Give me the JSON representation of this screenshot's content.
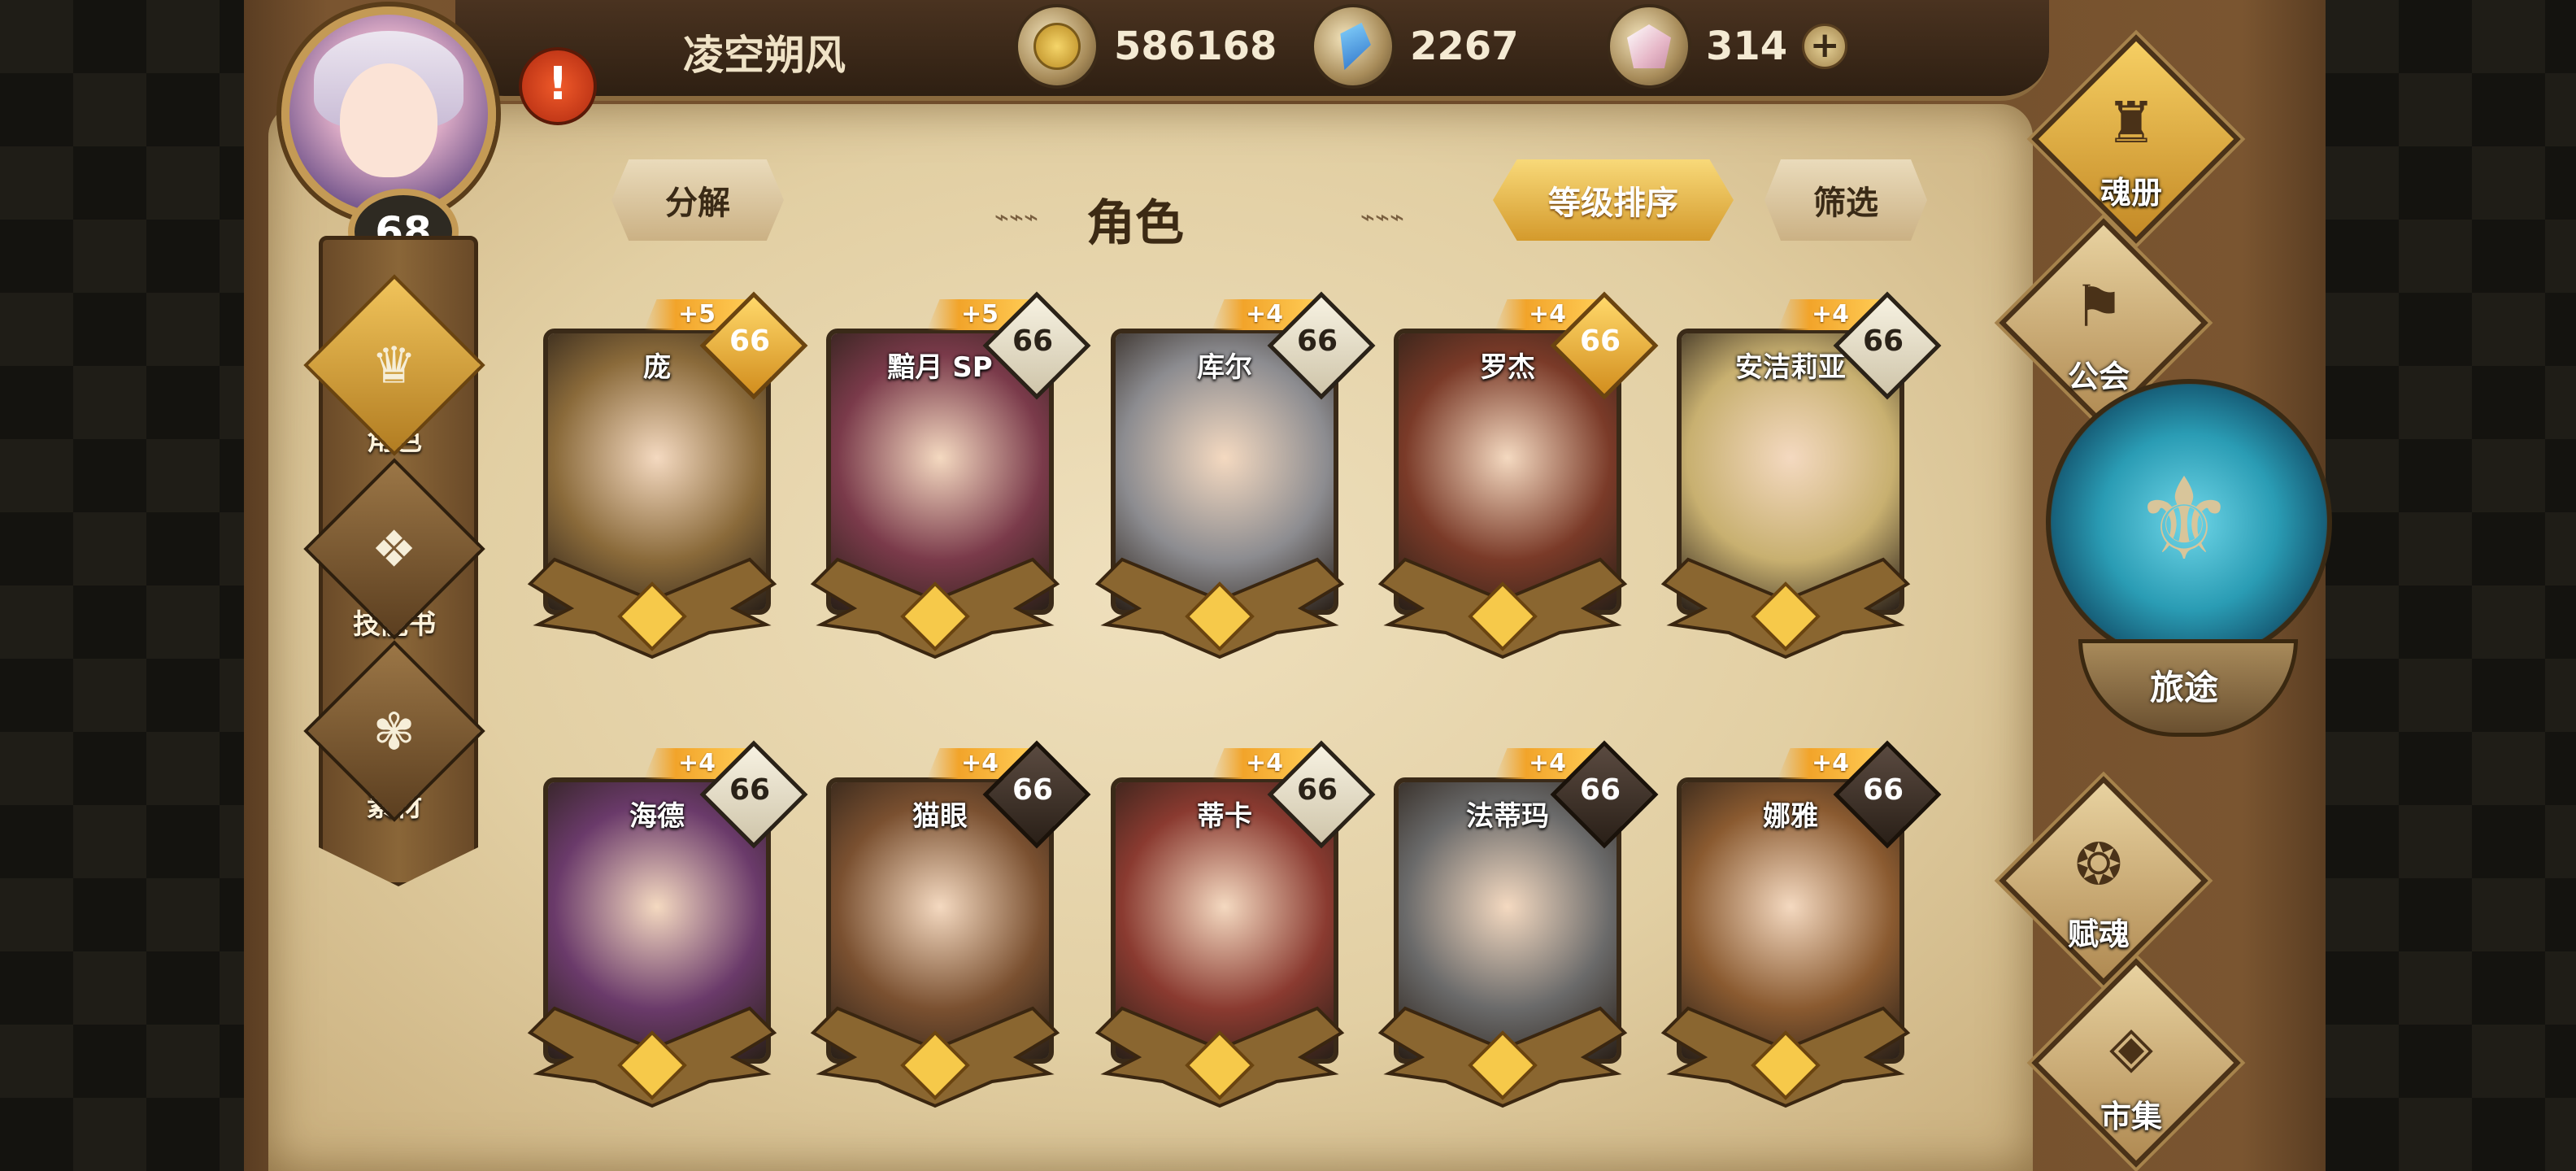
{
  "player": {
    "name": "凌空朔风",
    "level": "68",
    "alert": "!"
  },
  "resources": [
    {
      "icon": "gold-coin-icon",
      "value": "586168"
    },
    {
      "icon": "blue-gem-icon",
      "value": "2267"
    },
    {
      "icon": "pink-crystal-icon",
      "value": "314"
    }
  ],
  "add_label": "+",
  "header": {
    "title": "角色",
    "decompose": "分解",
    "sort": "等级排序",
    "filter": "筛选"
  },
  "left_menu": [
    {
      "label": "角色",
      "icon": "character-icon",
      "active": true
    },
    {
      "label": "技能书",
      "icon": "skill-book-icon",
      "active": false
    },
    {
      "label": "素材",
      "icon": "material-icon",
      "active": false
    }
  ],
  "cards": [
    {
      "name": "庞",
      "plus": "+5",
      "level": "66",
      "badge": "gold",
      "tint": "#8a6a3a"
    },
    {
      "name": "黯月 SP",
      "plus": "+5",
      "level": "66",
      "badge": "light",
      "tint": "#7a3a4a"
    },
    {
      "name": "库尔",
      "plus": "+4",
      "level": "66",
      "badge": "light",
      "tint": "#8c8c90"
    },
    {
      "name": "罗杰",
      "plus": "+4",
      "level": "66",
      "badge": "gold",
      "tint": "#7a3a28"
    },
    {
      "name": "安洁莉亚",
      "plus": "+4",
      "level": "66",
      "badge": "light",
      "tint": "#c8b070"
    },
    {
      "name": "海德",
      "plus": "+4",
      "level": "66",
      "badge": "light",
      "tint": "#6a3a6a"
    },
    {
      "name": "猫眼",
      "plus": "+4",
      "level": "66",
      "badge": "dark",
      "tint": "#7a5030"
    },
    {
      "name": "蒂卡",
      "plus": "+4",
      "level": "66",
      "badge": "light",
      "tint": "#8a3a30"
    },
    {
      "name": "法蒂玛",
      "plus": "+4",
      "level": "66",
      "badge": "dark",
      "tint": "#6a6a6a"
    },
    {
      "name": "娜雅",
      "plus": "+4",
      "level": "66",
      "badge": "dark",
      "tint": "#8a5a30"
    }
  ],
  "right_menu": {
    "soul_book": "魂册",
    "guild": "公会",
    "journey": "旅途",
    "endow": "赋魂",
    "market": "市集"
  }
}
